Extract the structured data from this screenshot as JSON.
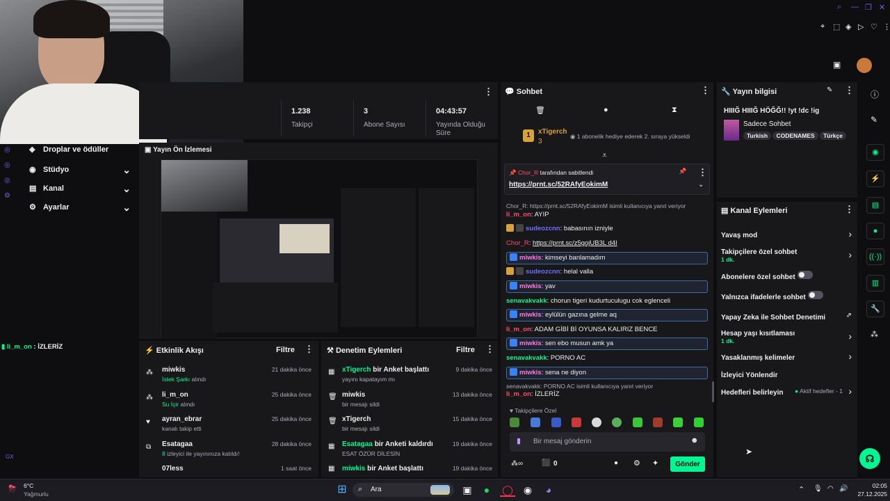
{
  "stats": [
    {
      "value": "1.238",
      "label": "Takipçi"
    },
    {
      "value": "3",
      "label": "Abone Sayısı"
    },
    {
      "value": "04:43:57",
      "label": "Yayında Olduğu Süre"
    }
  ],
  "left_menu": [
    {
      "label": "Droplar ve ödüller"
    },
    {
      "label": "Stüdyo"
    },
    {
      "label": "Kanal"
    },
    {
      "label": "Ayarlar"
    }
  ],
  "overlay_chat": {
    "user": "li_m_on",
    "text": "İZLERİZ"
  },
  "preview": {
    "title": "Yayın Ön İzlemesi"
  },
  "activity": {
    "title": "Etkinlik Akışı",
    "filter": "Filtre",
    "items": [
      {
        "user": "miwkis",
        "desc": "İstek Şarkı",
        "desc2": "alındı",
        "time": "21 dakika önce"
      },
      {
        "user": "li_m_on",
        "desc": "Su İçir",
        "desc2": "alındı",
        "time": "25 dakika önce"
      },
      {
        "user": "ayran_ebrar",
        "desc": "",
        "desc2": "kanalı takip etti",
        "time": "25 dakika önce"
      },
      {
        "user": "Esatagaa",
        "desc": "8",
        "desc2": "izleyici ile yayınınıza katıldı!",
        "time": "28 dakika önce"
      },
      {
        "user": "07less",
        "desc": "",
        "desc2": "",
        "time": "1 saat önce"
      }
    ]
  },
  "moderation": {
    "title": "Denetim Eylemleri",
    "filter": "Filtre",
    "items": [
      {
        "user": "xTigerch",
        "action": "bir Anket başlattı",
        "sub": "yayını kapatayım mı",
        "time": "9 dakika önce"
      },
      {
        "user": "miwkis",
        "action": "",
        "sub": "bir mesajı sildi",
        "time": "13 dakika önce"
      },
      {
        "user": "xTigerch",
        "action": "",
        "sub": "bir mesajı sildi",
        "time": "15 dakika önce"
      },
      {
        "user": "Esatagaa",
        "action": "bir Anketi kaldırdı",
        "sub": "ESAT ÖZÜR DİLESİN",
        "time": "19 dakika önce"
      },
      {
        "user": "miwkis",
        "action": "bir Anket başlattı",
        "sub": "",
        "time": "19 dakika önce"
      }
    ]
  },
  "chat": {
    "title": "Sohbet",
    "hype_user": "xTigerch",
    "hype_count": "3",
    "hype_text": "1 abonelik hediye ederek 2. sıraya yükseldi",
    "pinned_by": "Chor_R",
    "pinned_label": "tarafından sabitlendi",
    "pinned_link": "https://prnt.sc/52RAfyEokimM",
    "reply_note": "Chor_R: https://prnt.sc/52RAfyEokimM isimli kullanıcıya yanıt veriyor",
    "reply_note2": "senavakvakk: PORNO AC isimli kullanıcıya yanıt veriyor",
    "messages": [
      {
        "user": "li_m_on",
        "text": "AYIP"
      },
      {
        "user": "sudeozcnn",
        "text": "babasının izniyle"
      },
      {
        "user": "Chor_R",
        "text": "https://prnt.sc/z5gojUB3L d4I"
      },
      {
        "user": "miwkis",
        "text": "kimseyi banlamadım"
      },
      {
        "user": "sudeozcnn",
        "text": "helal valla"
      },
      {
        "user": "miwkis",
        "text": "yav"
      },
      {
        "user": "senavakvakk",
        "text": "chorun tigeri kudurtuculugu cok eglenceli"
      },
      {
        "user": "miwkis",
        "text": "eylülün gazına gelme aq"
      },
      {
        "user": "li_m_on",
        "text": "ADAM GİBİ Bİ OYUNSA KALIRIZ BENCE"
      },
      {
        "user": "miwkis",
        "text": "sen ebo musun amk ya"
      },
      {
        "user": "senavakvakk",
        "text": "PORNO AC"
      },
      {
        "user": "miwkis",
        "text": "sena ne diyon"
      },
      {
        "user": "li_m_on",
        "text": "İZLERİZ"
      }
    ],
    "emote_title": "Takipçilere Özel",
    "input_placeholder": "Bir mesaj gönderin",
    "points": "0",
    "send_label": "Gönder"
  },
  "stream_info": {
    "title": "Yayın bilgisi",
    "stream_title": "HIIIĞ HIIIĞ HÖĞĞ!! !yt !dc !ig",
    "category": "Sadece Sohbet",
    "tags": [
      "Turkish",
      "CODENAMES",
      "Türkçe"
    ]
  },
  "channel_actions": {
    "title": "Kanal Eylemleri",
    "items": [
      {
        "label": "Yavaş mod",
        "sub": ""
      },
      {
        "label": "Takipçilere özel sohbet",
        "sub": "1 dk."
      },
      {
        "label": "Abonelere özel sohbet",
        "sub": ""
      },
      {
        "label": "Yalnızca ifadelerle sohbet",
        "sub": ""
      },
      {
        "label": "Yapay Zeka ile Sohbet Denetimi",
        "sub": ""
      },
      {
        "label": "Hesap yaşı kısıtlaması",
        "sub": "1 dk."
      },
      {
        "label": "Yasaklanmış kelimeler",
        "sub": ""
      },
      {
        "label": "İzleyici Yönlendir",
        "sub": ""
      },
      {
        "label": "Hedefleri belirleyin",
        "sub": "Aktif hedefler - 1"
      }
    ]
  },
  "taskbar": {
    "weather_temp": "6°C",
    "weather_desc": "Yağmurlu",
    "search": "Ara",
    "time": "02:05",
    "date": "27.12.2025"
  },
  "colors": {
    "accent": "#00f593",
    "purple": "#bf94ff",
    "bg": "#0e0e10",
    "panel": "#18181b"
  }
}
